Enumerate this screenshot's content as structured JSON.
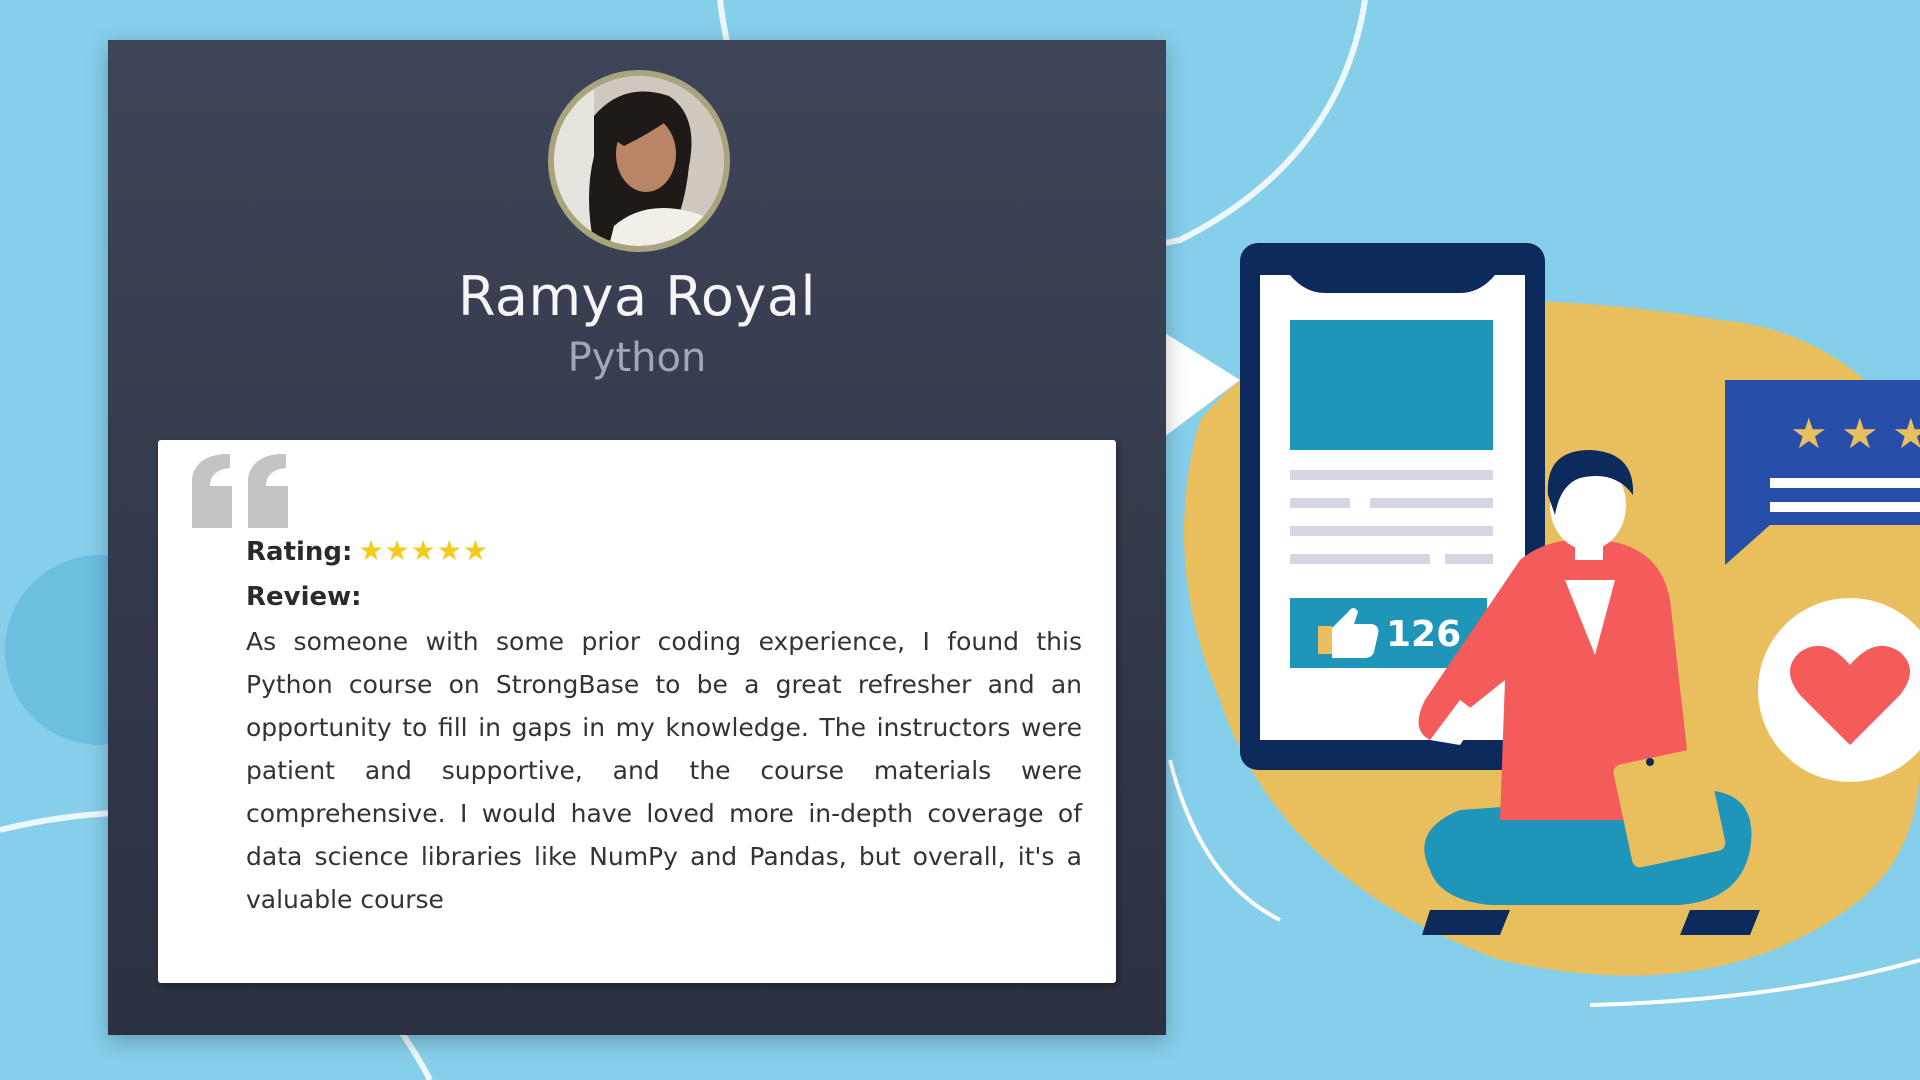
{
  "testimonial": {
    "name": "Ramya Royal",
    "course": "Python",
    "rating_label": "Rating:",
    "rating": 5,
    "stars": "★★★★★",
    "review_label": "Review:",
    "review_text": "As someone with some prior coding experience, I found this Python course on StrongBase to be a great refresher and an opportunity to fill in gaps in my knowledge. The instructors were patient and supportive, and the course materials were comprehensive. I would have loved more in-depth coverage of data science libraries like NumPy and Pandas, but overall, it's a valuable course"
  },
  "illustration": {
    "like_count": "126"
  },
  "colors": {
    "background": "#86cfea",
    "card": "#353b4d",
    "star": "#f7c91a",
    "blob": "#e9bf5e",
    "phone": "#0d2a5c",
    "shirt": "#f45b5b"
  }
}
